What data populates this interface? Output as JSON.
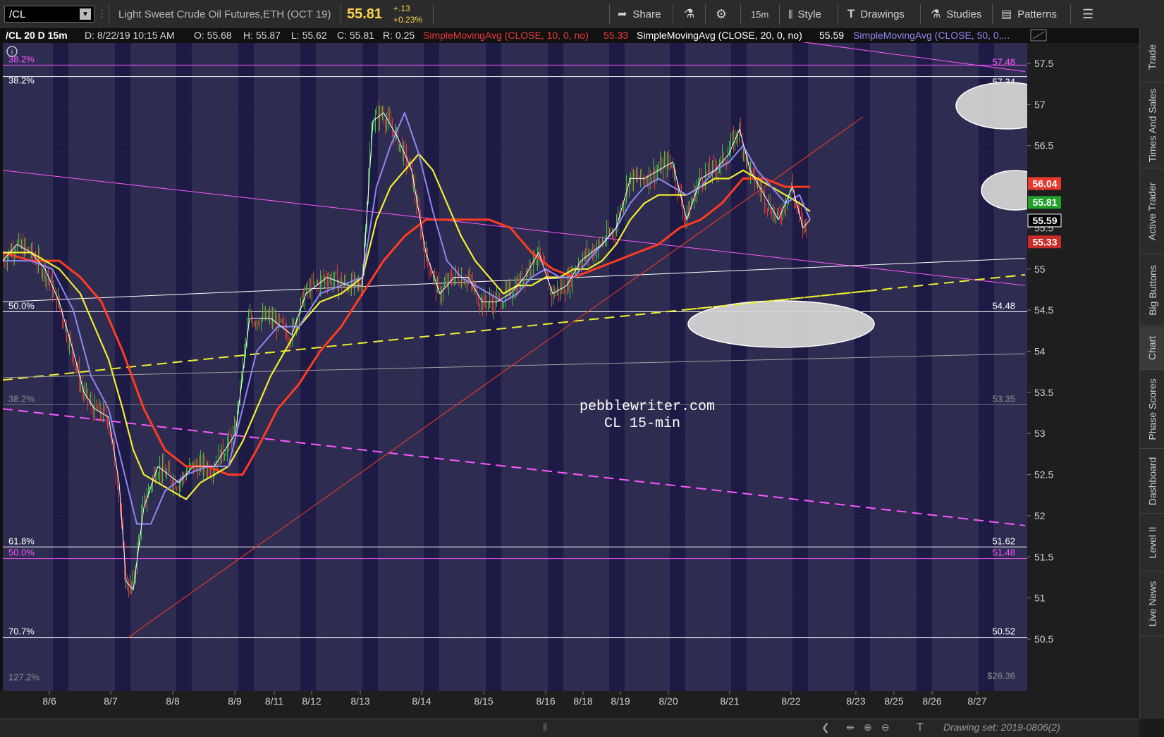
{
  "toolbar": {
    "symbol": "/CL",
    "description": "Light Sweet Crude Oil Futures,ETH (OCT 19)",
    "last_price": "55.81",
    "change_abs": "+.13",
    "change_pct": "+0.23%",
    "share_label": "Share",
    "timeframe_label": "15m",
    "style_label": "Style",
    "drawings_label": "Drawings",
    "studies_label": "Studies",
    "patterns_label": "Patterns"
  },
  "header": {
    "symbol_period": "/CL 20 D 15m",
    "date_label": "D: 8/22/19 10:15 AM",
    "open_label": "O: 55.68",
    "high_label": "H: 55.87",
    "low_label": "L: 55.62",
    "close_label": "C: 55.81",
    "range_label": "R: 0.25",
    "sma10_label": "SimpleMovingAvg (CLOSE, 10, 0, no)",
    "sma10_value": "55.33",
    "sma20_label": "SimpleMovingAvg (CLOSE, 20, 0, no)",
    "sma20_value": "55.59",
    "sma50_label": "SimpleMovingAvg (CLOSE, 50, 0,..."
  },
  "sidebar_tabs": [
    "Trade",
    "Times And Sales",
    "Active Trader",
    "Big Buttons",
    "Chart",
    "Phase Scores",
    "Dashboard",
    "Level II",
    "Live News"
  ],
  "bottom_bar": {
    "drawing_set": "Drawing set: 2019-0806(2)"
  },
  "watermark": {
    "line1": "pebblewriter.com",
    "line2": "CL 15-min"
  },
  "colors": {
    "background": "#2e2c51",
    "night_band": "#1d1b45",
    "sma10": "#ffffff",
    "sma20": "#8f86f2",
    "sma50": "#f2ef2f",
    "sma100": "#ff3b1f",
    "fib_white": "#ffffff",
    "fib_magenta": "#ff57ff",
    "candle_up": "#3ac43a",
    "candle_down": "#e03a3a"
  },
  "chart_data": {
    "type": "candlestick",
    "y_axis_ticks": [
      "57.5",
      "57",
      "56.5",
      "56",
      "55.5",
      "55",
      "54.5",
      "54",
      "53.5",
      "53",
      "52.5",
      "52",
      "51.5",
      "51",
      "50.5"
    ],
    "ylim": [
      50.3,
      57.9
    ],
    "x_tick_labels": [
      "8/6",
      "8/7",
      "8/8",
      "8/9",
      "8/11",
      "8/12",
      "8/13",
      "8/14",
      "8/15",
      "8/16",
      "8/18",
      "8/19",
      "8/20",
      "8/21",
      "8/22",
      "8/23",
      "8/25",
      "8/26",
      "8/27"
    ],
    "price_badges": [
      {
        "value": "56.04",
        "color": "#e8372b"
      },
      {
        "value": "55.81",
        "color": "#1fa12a"
      },
      {
        "value": "55.59",
        "color": "#000000"
      },
      {
        "value": "55.33",
        "color": "#c92b2b"
      }
    ],
    "fib_levels": [
      {
        "pct": "38.2%",
        "price": "57.48",
        "color": "#ff57ff"
      },
      {
        "pct": "38.2%",
        "price": "57.34",
        "color": "#ffffff"
      },
      {
        "pct": "50.0%",
        "price": "54.48",
        "color": "#ffffff"
      },
      {
        "pct": "38.2%",
        "price": "53.35",
        "color": "#8d8d8d"
      },
      {
        "pct": "61.8%",
        "price": "51.62",
        "color": "#ffffff"
      },
      {
        "pct": "50.0%",
        "price": "51.48",
        "color": "#ff57ff"
      },
      {
        "pct": "70.7%",
        "price": "50.52",
        "color": "#ffffff"
      },
      {
        "pct": "127.2%",
        "price": "$26.36",
        "color": "#8d8d8d"
      }
    ],
    "series": [
      {
        "name": "SimpleMovingAvg (CLOSE, 10, 0, no)",
        "color": "#ffffff",
        "points": [
          [
            0,
            55.1
          ],
          [
            20,
            55.3
          ],
          [
            40,
            55.2
          ],
          [
            60,
            55.0
          ],
          [
            80,
            54.6
          ],
          [
            100,
            54.0
          ],
          [
            115,
            53.5
          ],
          [
            130,
            53.3
          ],
          [
            150,
            53.2
          ],
          [
            165,
            52.4
          ],
          [
            175,
            51.2
          ],
          [
            185,
            51.1
          ],
          [
            200,
            52.1
          ],
          [
            220,
            52.6
          ],
          [
            250,
            52.4
          ],
          [
            270,
            52.6
          ],
          [
            300,
            52.6
          ],
          [
            330,
            53.0
          ],
          [
            350,
            54.4
          ],
          [
            380,
            54.4
          ],
          [
            410,
            54.2
          ],
          [
            430,
            54.7
          ],
          [
            460,
            54.9
          ],
          [
            490,
            54.8
          ],
          [
            510,
            54.8
          ],
          [
            525,
            56.8
          ],
          [
            540,
            56.9
          ],
          [
            560,
            56.6
          ],
          [
            580,
            56.2
          ],
          [
            600,
            55.2
          ],
          [
            620,
            54.7
          ],
          [
            640,
            54.9
          ],
          [
            660,
            54.9
          ],
          [
            680,
            54.6
          ],
          [
            700,
            54.6
          ],
          [
            720,
            54.7
          ],
          [
            740,
            54.9
          ],
          [
            760,
            55.2
          ],
          [
            780,
            54.7
          ],
          [
            800,
            54.8
          ],
          [
            820,
            55.1
          ],
          [
            850,
            55.3
          ],
          [
            870,
            55.5
          ],
          [
            890,
            56.1
          ],
          [
            910,
            56.1
          ],
          [
            930,
            56.2
          ],
          [
            950,
            56.3
          ],
          [
            970,
            55.6
          ],
          [
            990,
            56.1
          ],
          [
            1010,
            56.2
          ],
          [
            1030,
            56.4
          ],
          [
            1045,
            56.7
          ],
          [
            1060,
            56.2
          ],
          [
            1080,
            55.9
          ],
          [
            1100,
            55.6
          ],
          [
            1120,
            56.0
          ],
          [
            1135,
            55.5
          ],
          [
            1145,
            55.6
          ]
        ]
      },
      {
        "name": "SimpleMovingAvg (CLOSE, 20, 0, no)",
        "color": "#8f86f2",
        "points": [
          [
            0,
            55.1
          ],
          [
            40,
            55.1
          ],
          [
            70,
            55.0
          ],
          [
            100,
            54.5
          ],
          [
            125,
            53.7
          ],
          [
            150,
            53.3
          ],
          [
            170,
            52.6
          ],
          [
            190,
            51.9
          ],
          [
            210,
            51.9
          ],
          [
            230,
            52.3
          ],
          [
            260,
            52.5
          ],
          [
            290,
            52.6
          ],
          [
            320,
            52.6
          ],
          [
            340,
            53.3
          ],
          [
            360,
            54.0
          ],
          [
            390,
            54.3
          ],
          [
            420,
            54.3
          ],
          [
            450,
            54.7
          ],
          [
            480,
            54.8
          ],
          [
            510,
            54.9
          ],
          [
            530,
            56.0
          ],
          [
            550,
            56.5
          ],
          [
            570,
            56.9
          ],
          [
            590,
            56.4
          ],
          [
            610,
            55.7
          ],
          [
            630,
            55.1
          ],
          [
            650,
            54.9
          ],
          [
            670,
            54.8
          ],
          [
            690,
            54.7
          ],
          [
            710,
            54.6
          ],
          [
            730,
            54.7
          ],
          [
            750,
            54.9
          ],
          [
            770,
            55.0
          ],
          [
            790,
            54.9
          ],
          [
            810,
            54.9
          ],
          [
            830,
            55.1
          ],
          [
            850,
            55.3
          ],
          [
            870,
            55.5
          ],
          [
            890,
            55.8
          ],
          [
            910,
            56.0
          ],
          [
            930,
            56.1
          ],
          [
            950,
            56.0
          ],
          [
            970,
            55.9
          ],
          [
            990,
            56.0
          ],
          [
            1010,
            56.2
          ],
          [
            1030,
            56.3
          ],
          [
            1050,
            56.5
          ],
          [
            1070,
            56.2
          ],
          [
            1090,
            56.0
          ],
          [
            1110,
            55.8
          ],
          [
            1130,
            55.9
          ],
          [
            1145,
            55.6
          ]
        ]
      },
      {
        "name": "SimpleMovingAvg (CLOSE, 50, 0, no)",
        "color": "#f2ef2f",
        "points": [
          [
            0,
            55.2
          ],
          [
            40,
            55.2
          ],
          [
            80,
            55.0
          ],
          [
            110,
            54.7
          ],
          [
            130,
            54.3
          ],
          [
            150,
            53.9
          ],
          [
            170,
            53.3
          ],
          [
            185,
            52.8
          ],
          [
            200,
            52.5
          ],
          [
            220,
            52.4
          ],
          [
            240,
            52.3
          ],
          [
            260,
            52.2
          ],
          [
            280,
            52.4
          ],
          [
            300,
            52.5
          ],
          [
            320,
            52.6
          ],
          [
            340,
            52.9
          ],
          [
            360,
            53.3
          ],
          [
            380,
            53.7
          ],
          [
            400,
            54.0
          ],
          [
            420,
            54.3
          ],
          [
            450,
            54.6
          ],
          [
            480,
            54.7
          ],
          [
            510,
            54.9
          ],
          [
            530,
            55.6
          ],
          [
            550,
            56.0
          ],
          [
            570,
            56.2
          ],
          [
            590,
            56.4
          ],
          [
            610,
            56.2
          ],
          [
            630,
            55.8
          ],
          [
            650,
            55.4
          ],
          [
            670,
            55.1
          ],
          [
            690,
            54.9
          ],
          [
            710,
            54.7
          ],
          [
            730,
            54.8
          ],
          [
            750,
            54.8
          ],
          [
            770,
            54.9
          ],
          [
            790,
            54.9
          ],
          [
            810,
            55.0
          ],
          [
            830,
            55.0
          ],
          [
            850,
            55.1
          ],
          [
            870,
            55.3
          ],
          [
            890,
            55.6
          ],
          [
            910,
            55.8
          ],
          [
            930,
            55.9
          ],
          [
            950,
            55.9
          ],
          [
            970,
            55.9
          ],
          [
            990,
            56.0
          ],
          [
            1010,
            56.1
          ],
          [
            1030,
            56.1
          ],
          [
            1050,
            56.2
          ],
          [
            1070,
            56.1
          ],
          [
            1090,
            56.0
          ],
          [
            1110,
            55.9
          ],
          [
            1130,
            55.8
          ],
          [
            1145,
            55.7
          ]
        ]
      },
      {
        "name": "",
        "color": "#ff3b1f",
        "points": [
          [
            0,
            55.2
          ],
          [
            40,
            55.1
          ],
          [
            80,
            55.1
          ],
          [
            110,
            54.9
          ],
          [
            140,
            54.6
          ],
          [
            170,
            54.0
          ],
          [
            200,
            53.3
          ],
          [
            230,
            52.8
          ],
          [
            260,
            52.6
          ],
          [
            290,
            52.6
          ],
          [
            320,
            52.5
          ],
          [
            340,
            52.5
          ],
          [
            360,
            52.8
          ],
          [
            390,
            53.3
          ],
          [
            420,
            53.6
          ],
          [
            450,
            54.0
          ],
          [
            480,
            54.3
          ],
          [
            510,
            54.7
          ],
          [
            540,
            55.1
          ],
          [
            570,
            55.4
          ],
          [
            600,
            55.6
          ],
          [
            630,
            55.6
          ],
          [
            660,
            55.6
          ],
          [
            690,
            55.6
          ],
          [
            720,
            55.5
          ],
          [
            750,
            55.2
          ],
          [
            780,
            55.0
          ],
          [
            810,
            54.9
          ],
          [
            840,
            55.0
          ],
          [
            870,
            55.1
          ],
          [
            900,
            55.2
          ],
          [
            930,
            55.3
          ],
          [
            960,
            55.5
          ],
          [
            990,
            55.6
          ],
          [
            1020,
            55.8
          ],
          [
            1050,
            56.1
          ],
          [
            1080,
            56.1
          ],
          [
            1110,
            56.0
          ],
          [
            1145,
            56.0
          ]
        ]
      }
    ],
    "trendlines": [
      {
        "style": "solid",
        "color": "#ff57ff",
        "from": [
          0,
          56.2
        ],
        "to": [
          1450,
          54.8
        ]
      },
      {
        "style": "solid",
        "color": "#ff57ff",
        "from": [
          1100,
          57.8
        ],
        "to": [
          1450,
          57.4
        ]
      },
      {
        "style": "dashed",
        "color": "#f2ef2f",
        "from": [
          0,
          53.65
        ],
        "to": [
          1450,
          54.93
        ]
      },
      {
        "style": "dashed",
        "color": "#ff57ff",
        "from": [
          0,
          53.3
        ],
        "to": [
          1450,
          51.88
        ]
      },
      {
        "style": "solid",
        "color": "#ffffff",
        "from": [
          0,
          54.6
        ],
        "to": [
          1450,
          55.13
        ]
      },
      {
        "style": "solid",
        "color": "#a0a0a0",
        "from": [
          0,
          53.68
        ],
        "to": [
          1450,
          53.97
        ]
      },
      {
        "style": "solid",
        "color": "#ff3b1f",
        "from": [
          178,
          50.52
        ],
        "to": [
          1220,
          56.85
        ]
      }
    ]
  }
}
